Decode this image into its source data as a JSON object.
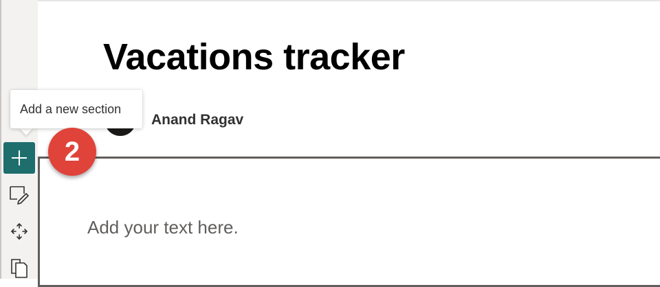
{
  "page": {
    "title": "Vacations tracker",
    "author": "Anand Ragav"
  },
  "tooltip": {
    "text": "Add a new section"
  },
  "section": {
    "placeholder": "Add your text here."
  },
  "toolbar": {
    "add_section_icon": "plus-icon",
    "edit_icon": "edit-section-icon",
    "move_icon": "move-icon",
    "duplicate_icon": "duplicate-icon"
  },
  "annotation": {
    "step_number": "2"
  },
  "colors": {
    "add_button": "#1e6e6e",
    "step_badge": "#e0433a",
    "section_border": "#605e5c"
  }
}
